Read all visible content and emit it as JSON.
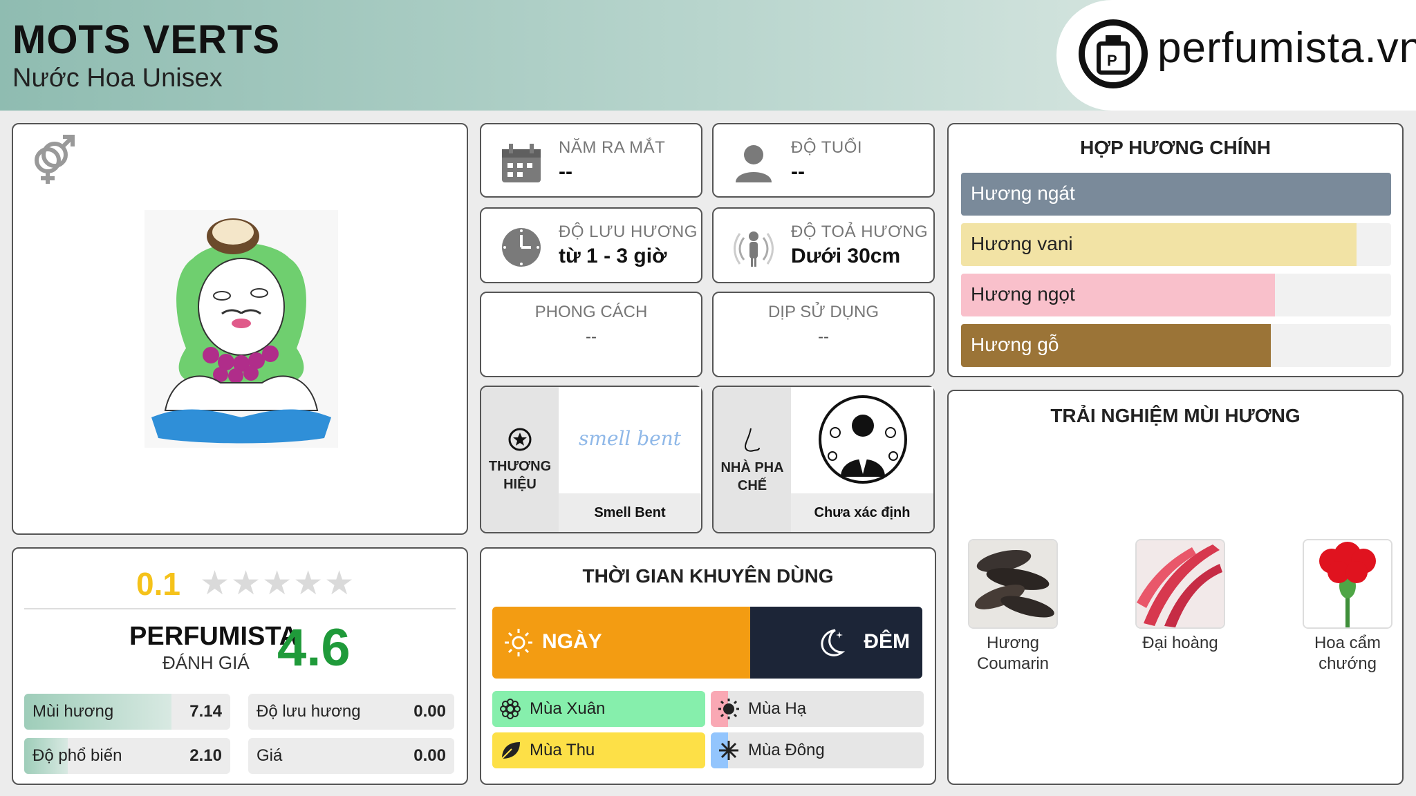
{
  "header": {
    "title": "MOTS VERTS",
    "subtitle": "Nước Hoa Unisex",
    "logo_text": "perfumista.vn",
    "logo_icon": "perfume-bottle-icon"
  },
  "image_card": {
    "gender_icon": "unisex-gender-icon"
  },
  "info": {
    "launch_year": {
      "label": "NĂM RA MẮT",
      "value": "--",
      "icon": "calendar-icon"
    },
    "age": {
      "label": "ĐỘ TUỔI",
      "value": "--",
      "icon": "person-icon"
    },
    "longevity": {
      "label": "ĐỘ LƯU HƯƠNG",
      "value": "từ 1 - 3 giờ",
      "icon": "clock-icon"
    },
    "sillage": {
      "label": "ĐỘ TOẢ HƯƠNG",
      "value": "Dưới 30cm",
      "icon": "sillage-icon"
    },
    "style": {
      "label": "PHONG CÁCH",
      "value": "--"
    },
    "occasion": {
      "label": "DỊP SỬ DỤNG",
      "value": "--"
    }
  },
  "brand": {
    "label_line1": "THƯƠNG",
    "label_line2": "HIỆU",
    "name": "Smell Bent",
    "logo_text": "smell bent",
    "icon": "star-badge-icon"
  },
  "perfumer": {
    "label_line1": "NHÀ PHA",
    "label_line2": "CHẾ",
    "name": "Chưa xác định",
    "icon": "nose-icon"
  },
  "accords": {
    "title": "HỢP HƯƠNG CHÍNH",
    "items": [
      {
        "label": "Hương ngát",
        "value": 100,
        "color": "#7a8a9a",
        "text_color": "#ffffff"
      },
      {
        "label": "Hương vani",
        "value": 92,
        "color": "#f2e3a5",
        "text_color": "#222222"
      },
      {
        "label": "Hương ngọt",
        "value": 73,
        "color": "#f9c0cb",
        "text_color": "#222222"
      },
      {
        "label": "Hương gỗ",
        "value": 72,
        "color": "#9b7437",
        "text_color": "#ffffff"
      }
    ]
  },
  "notes": {
    "title": "TRẢI NGHIỆM MÙI HƯƠNG",
    "items": [
      {
        "line1": "Hương",
        "line2": "Coumarin"
      },
      {
        "line1": "Đại hoàng",
        "line2": ""
      },
      {
        "line1": "Hoa cẩm",
        "line2": "chướng"
      }
    ]
  },
  "rating": {
    "score": "0.1",
    "stars_max": 5,
    "perfumista_title": "PERFUMISTA",
    "perfumista_sub": "ĐÁNH GIÁ",
    "perfumista_score": "4.6",
    "metrics": [
      {
        "label": "Mùi hương",
        "value": "7.14",
        "fill": 0.714
      },
      {
        "label": "Độ lưu hương",
        "value": "0.00",
        "fill": 0
      },
      {
        "label": "Độ phổ biến",
        "value": "2.10",
        "fill": 0.21
      },
      {
        "label": "Giá",
        "value": "0.00",
        "fill": 0
      }
    ]
  },
  "time": {
    "title": "THỜI GIAN KHUYÊN DÙNG",
    "day_label": "NGÀY",
    "night_label": "ĐÊM",
    "day_fraction": 0.6,
    "seasons": [
      {
        "label": "Mùa Xuân",
        "fill": 1.0,
        "color": "#86efac",
        "icon": "flower-icon"
      },
      {
        "label": "Mùa Hạ",
        "fill": 0.08,
        "color": "#f9a8b4",
        "icon": "sun-icon"
      },
      {
        "label": "Mùa Thu",
        "fill": 1.0,
        "color": "#fde047",
        "icon": "leaf-icon"
      },
      {
        "label": "Mùa Đông",
        "fill": 0.08,
        "color": "#93c5fd",
        "icon": "snowflake-icon"
      }
    ]
  }
}
